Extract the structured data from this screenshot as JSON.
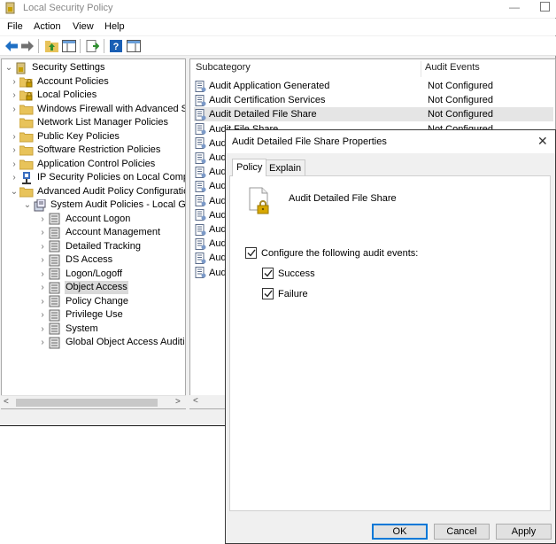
{
  "window": {
    "title": "Local Security Policy"
  },
  "menu": [
    "File",
    "Action",
    "View",
    "Help"
  ],
  "tree": [
    {
      "label": "Security Settings",
      "level": 0,
      "expander": "v",
      "icon": "shield-icon"
    },
    {
      "label": "Account Policies",
      "level": 1,
      "expander": ">",
      "icon": "folder-lock-icon"
    },
    {
      "label": "Local Policies",
      "level": 1,
      "expander": ">",
      "icon": "folder-lock-icon"
    },
    {
      "label": "Windows Firewall with Advanced Secu",
      "level": 1,
      "expander": ">",
      "icon": "folder-icon"
    },
    {
      "label": "Network List Manager Policies",
      "level": 1,
      "expander": "",
      "icon": "folder-icon"
    },
    {
      "label": "Public Key Policies",
      "level": 1,
      "expander": ">",
      "icon": "folder-icon"
    },
    {
      "label": "Software Restriction Policies",
      "level": 1,
      "expander": ">",
      "icon": "folder-icon"
    },
    {
      "label": "Application Control Policies",
      "level": 1,
      "expander": ">",
      "icon": "folder-icon"
    },
    {
      "label": "IP Security Policies on Local Compute",
      "level": 1,
      "expander": ">",
      "icon": "ipsec-icon"
    },
    {
      "label": "Advanced Audit Policy Configuration",
      "level": 1,
      "expander": "v",
      "icon": "folder-icon"
    },
    {
      "label": "System Audit Policies - Local Grou",
      "level": 2,
      "expander": "v",
      "icon": "audit-policy-icon"
    },
    {
      "label": "Account Logon",
      "level": 3,
      "expander": ">",
      "icon": "audit-category-icon"
    },
    {
      "label": "Account Management",
      "level": 3,
      "expander": ">",
      "icon": "audit-category-icon"
    },
    {
      "label": "Detailed Tracking",
      "level": 3,
      "expander": ">",
      "icon": "audit-category-icon"
    },
    {
      "label": "DS Access",
      "level": 3,
      "expander": ">",
      "icon": "audit-category-icon"
    },
    {
      "label": "Logon/Logoff",
      "level": 3,
      "expander": ">",
      "icon": "audit-category-icon"
    },
    {
      "label": "Object Access",
      "level": 3,
      "expander": ">",
      "icon": "audit-category-icon",
      "selected": true
    },
    {
      "label": "Policy Change",
      "level": 3,
      "expander": ">",
      "icon": "audit-category-icon"
    },
    {
      "label": "Privilege Use",
      "level": 3,
      "expander": ">",
      "icon": "audit-category-icon"
    },
    {
      "label": "System",
      "level": 3,
      "expander": ">",
      "icon": "audit-category-icon"
    },
    {
      "label": "Global Object Access Auditing",
      "level": 3,
      "expander": ">",
      "icon": "audit-category-icon"
    }
  ],
  "list": {
    "columns": [
      "Subcategory",
      "Audit Events"
    ],
    "rows": [
      {
        "name": "Audit Application Generated",
        "value": "Not Configured"
      },
      {
        "name": "Audit Certification Services",
        "value": "Not Configured"
      },
      {
        "name": "Audit Detailed File Share",
        "value": "Not Configured",
        "selected": true
      },
      {
        "name": "Audit File Share",
        "value": "Not Configured"
      },
      {
        "name": "Audit",
        "value": ""
      },
      {
        "name": "Audit",
        "value": ""
      },
      {
        "name": "Audit",
        "value": ""
      },
      {
        "name": "Audit",
        "value": ""
      },
      {
        "name": "Audit",
        "value": ""
      },
      {
        "name": "Audit",
        "value": ""
      },
      {
        "name": "Audit",
        "value": ""
      },
      {
        "name": "Audit",
        "value": ""
      },
      {
        "name": "Audit",
        "value": ""
      },
      {
        "name": "Audit",
        "value": ""
      }
    ]
  },
  "dialog": {
    "title": "Audit Detailed File Share Properties",
    "tabs": [
      "Policy",
      "Explain"
    ],
    "heading": "Audit Detailed File Share",
    "configure_label": "Configure the following audit events:",
    "success_label": "Success",
    "failure_label": "Failure",
    "configure_checked": true,
    "success_checked": true,
    "failure_checked": true,
    "buttons": {
      "ok": "OK",
      "cancel": "Cancel",
      "apply": "Apply"
    }
  }
}
